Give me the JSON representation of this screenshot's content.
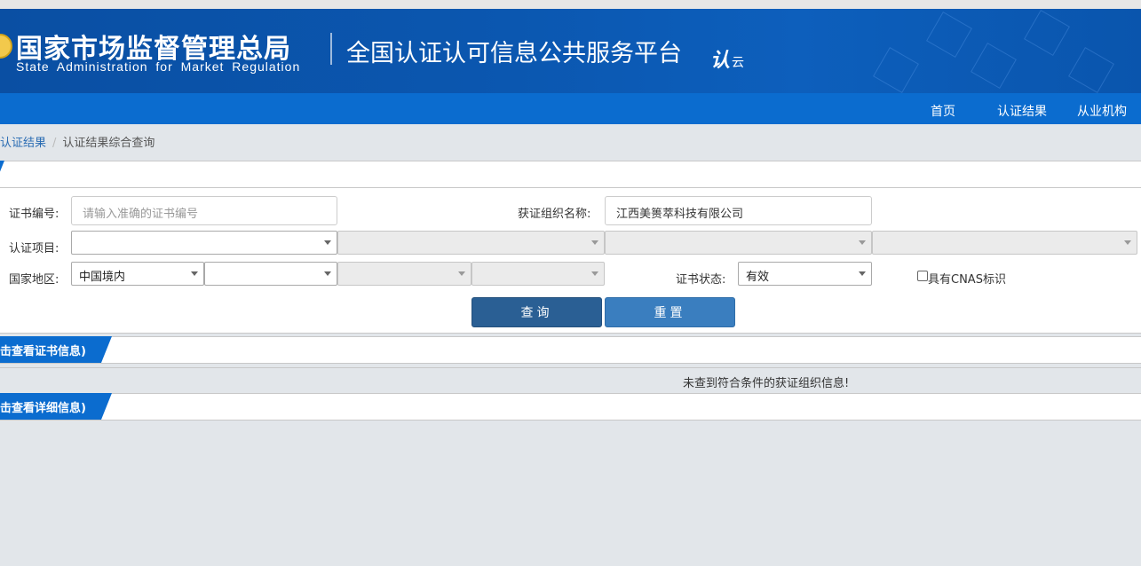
{
  "header": {
    "agency_cn": "国家市场监督管理总局",
    "agency_en": "State Administration  for  Market Regulation",
    "platform_title": "全国认证认可信息公共服务平台",
    "platform_logo": "认",
    "platform_logo_sub": "云"
  },
  "nav": {
    "items": [
      "首页",
      "认证结果",
      "从业机构"
    ]
  },
  "breadcrumb": {
    "link": "认证结果",
    "sep": "/",
    "current": "认证结果综合查询"
  },
  "form": {
    "cert_no_label": "证书编号:",
    "cert_no_placeholder": "请输入准确的证书编号",
    "org_label": "获证组织名称:",
    "org_value": "江西美篑萃科技有限公司",
    "project_label": "认证项目:",
    "project_selects": [
      "",
      "",
      "",
      ""
    ],
    "region_label": "国家地区:",
    "region_selects": [
      "中国境内",
      "",
      "",
      ""
    ],
    "status_label": "证书状态:",
    "status_value": "有效",
    "cnas_label": "具有CNAS标识",
    "query_button": "查询",
    "reset_button": "重置"
  },
  "sections": {
    "cert_tab": "击查看证书信息)",
    "detail_tab": "击查看详细信息)",
    "no_result": "未查到符合条件的获证组织信息!"
  },
  "colors": {
    "primary": "#0b6ccf",
    "query_button": "#2a5f94",
    "reset_button": "#3a7ebf"
  }
}
